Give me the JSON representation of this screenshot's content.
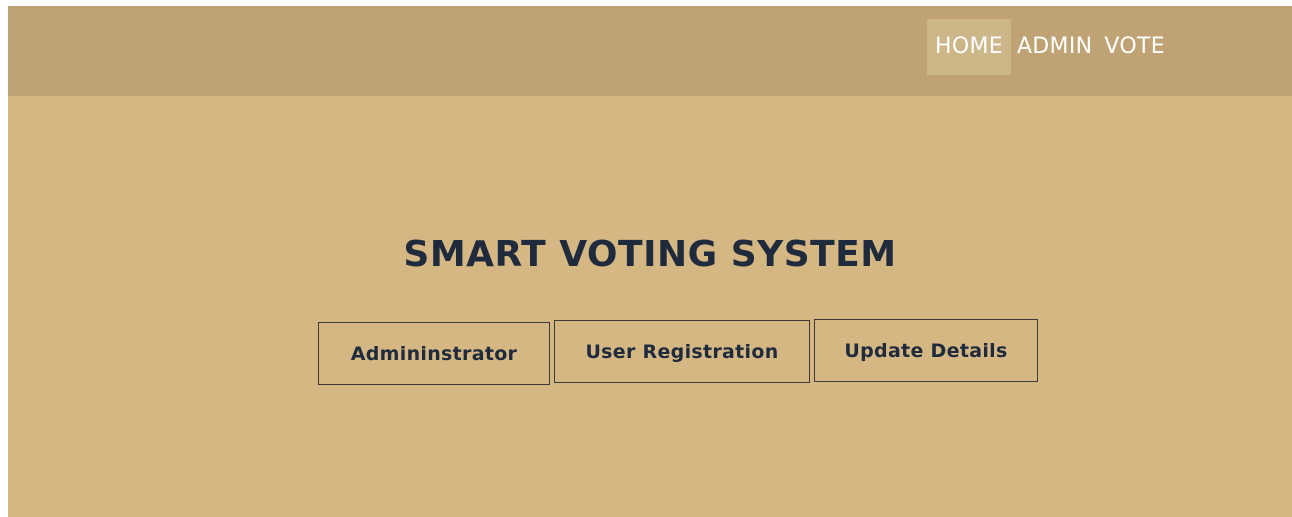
{
  "nav": {
    "items": [
      {
        "label": "HOME",
        "active": true
      },
      {
        "label": "ADMIN",
        "active": false
      },
      {
        "label": "VOTE",
        "active": false
      }
    ]
  },
  "hero": {
    "title": "SMART VOTING SYSTEM"
  },
  "actions": {
    "administrator_label": "Admininstrator",
    "user_registration_label": "User Registration",
    "update_details_label": "Update Details"
  },
  "colors": {
    "header_bg": "#c0a375",
    "page_bg": "#d4b783",
    "active_nav_bg": "#cdb688",
    "title_text": "#1f2a3c"
  }
}
